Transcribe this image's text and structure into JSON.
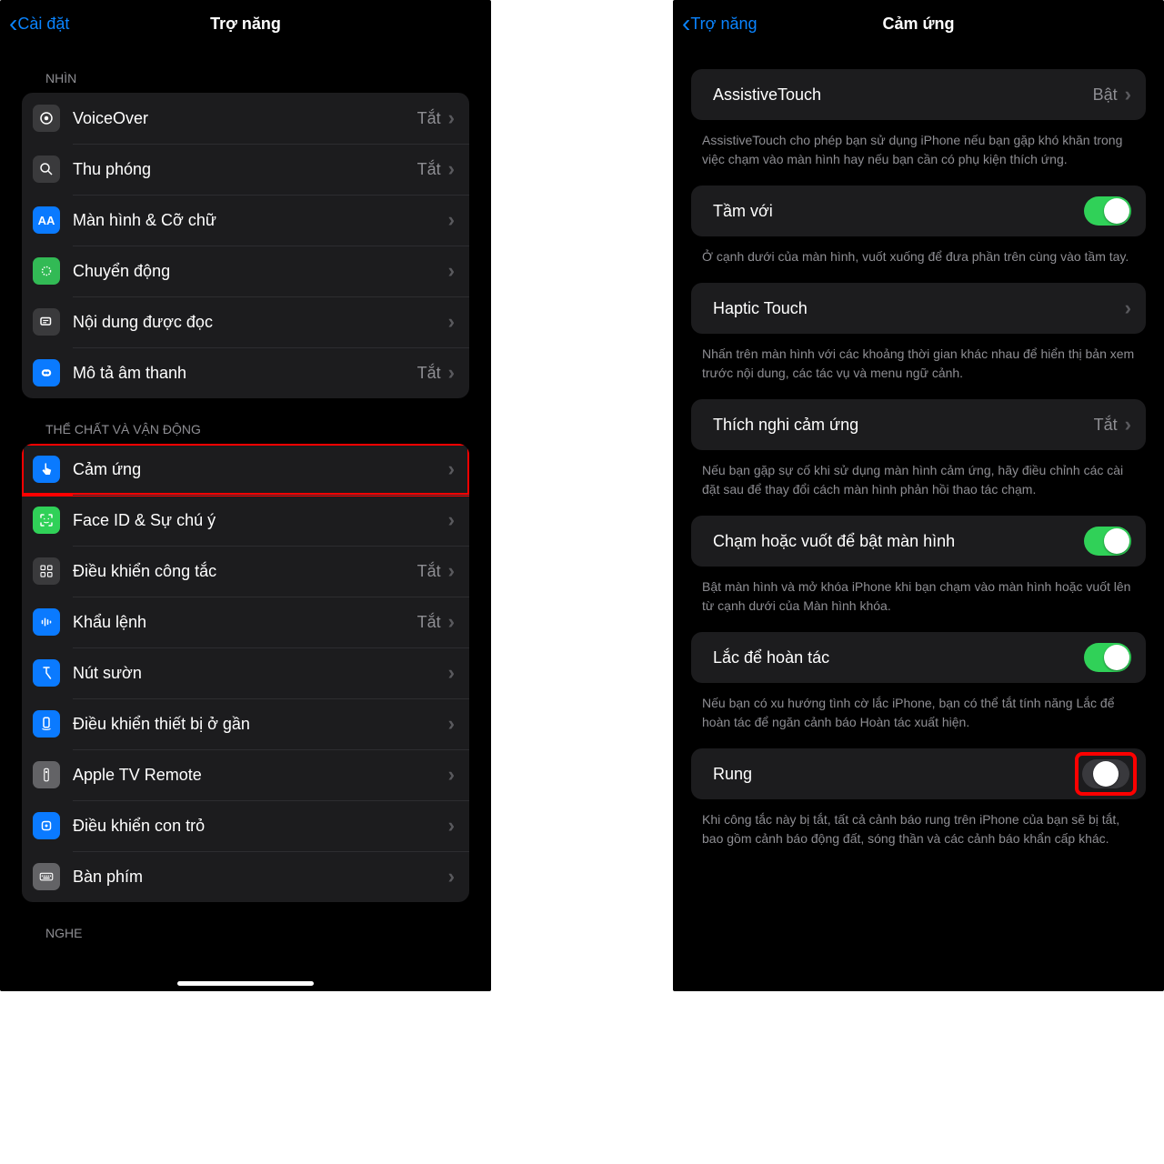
{
  "left": {
    "nav": {
      "back": "Cài đặt",
      "title": "Trợ năng"
    },
    "sections": {
      "vision": {
        "header": "NHÌN",
        "rows": {
          "voiceover": {
            "label": "VoiceOver",
            "value": "Tắt"
          },
          "zoom": {
            "label": "Thu phóng",
            "value": "Tắt"
          },
          "display": {
            "label": "Màn hình & Cỡ chữ",
            "value": ""
          },
          "motion": {
            "label": "Chuyển động",
            "value": ""
          },
          "speech": {
            "label": "Nội dung được đọc",
            "value": ""
          },
          "audiodesc": {
            "label": "Mô tả âm thanh",
            "value": "Tắt"
          }
        }
      },
      "physical": {
        "header": "THỂ CHẤT VÀ VẬN ĐỘNG",
        "rows": {
          "touch": {
            "label": "Cảm ứng",
            "value": ""
          },
          "faceid": {
            "label": "Face ID & Sự chú ý",
            "value": ""
          },
          "switchctl": {
            "label": "Điều khiển công tắc",
            "value": "Tắt"
          },
          "voicectl": {
            "label": "Khẩu lệnh",
            "value": "Tắt"
          },
          "sidebtn": {
            "label": "Nút sườn",
            "value": ""
          },
          "nearby": {
            "label": "Điều khiển thiết bị ở gần",
            "value": ""
          },
          "tvremote": {
            "label": "Apple TV Remote",
            "value": ""
          },
          "pointer": {
            "label": "Điều khiển con trỏ",
            "value": ""
          },
          "keyboard": {
            "label": "Bàn phím",
            "value": ""
          }
        }
      },
      "hearing": {
        "header": "NGHE"
      }
    }
  },
  "right": {
    "nav": {
      "back": "Trợ năng",
      "title": "Cảm ứng"
    },
    "items": {
      "assistive": {
        "label": "AssistiveTouch",
        "value": "Bật",
        "footer": "AssistiveTouch cho phép bạn sử dụng iPhone nếu bạn gặp khó khăn trong việc chạm vào màn hình hay nếu bạn cần có phụ kiện thích ứng."
      },
      "reach": {
        "label": "Tầm với",
        "footer": "Ở cạnh dưới của màn hình, vuốt xuống để đưa phần trên cùng vào tầm tay."
      },
      "haptic": {
        "label": "Haptic Touch",
        "footer": "Nhấn trên màn hình với các khoảng thời gian khác nhau để hiển thị bản xem trước nội dung, các tác vụ và menu ngữ cảnh."
      },
      "accom": {
        "label": "Thích nghi cảm ứng",
        "value": "Tắt",
        "footer": "Nếu bạn gặp sự cố khi sử dụng màn hình cảm ứng, hãy điều chỉnh các cài đặt sau để thay đổi cách màn hình phản hồi thao tác chạm."
      },
      "tapwake": {
        "label": "Chạm hoặc vuốt để bật màn hình",
        "footer": "Bật màn hình và mở khóa iPhone khi bạn chạm vào màn hình hoặc vuốt lên từ cạnh dưới của Màn hình khóa."
      },
      "shake": {
        "label": "Lắc để hoàn tác",
        "footer": "Nếu bạn có xu hướng tình cờ lắc iPhone, bạn có thể tắt tính năng Lắc để hoàn tác để ngăn cảnh báo Hoàn tác xuất hiện."
      },
      "vibration": {
        "label": "Rung",
        "footer": "Khi công tắc này bị tắt, tất cả cảnh báo rung trên iPhone của bạn sẽ bị tắt, bao gồm cảnh báo động đất, sóng thần và các cảnh báo khẩn cấp khác."
      }
    }
  }
}
